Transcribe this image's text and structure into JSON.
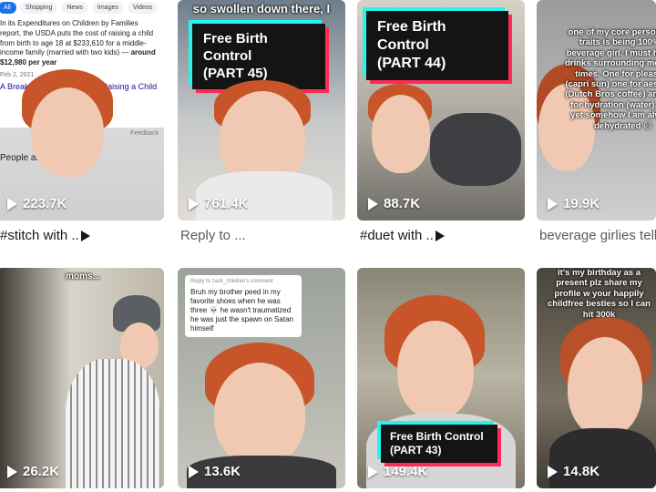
{
  "tiles": [
    {
      "views": "223.7K",
      "caption": "#stitch",
      "caption_rest": " with ..",
      "google": {
        "tabs": [
          "All",
          "Shopping",
          "News",
          "Images",
          "Videos"
        ],
        "snippet_pre": "In its Expenditures on Children by Families report, the USDA puts the cost of raising a child from birth to age 18 at $233,610 for a middle-income family (married with two kids) — ",
        "snippet_bold": "around $12,980 per year",
        "date": "Feb 2, 2021",
        "link": "A Breakdown of the Cost of Raising a Child",
        "feedback": "Feedback",
        "people": "People also ask"
      }
    },
    {
      "views": "761.4K",
      "caption": "Reply to ...",
      "top_text": "so swollen down there, I",
      "box_text": "Free Birth Control\n(PART 45)"
    },
    {
      "views": "88.7K",
      "caption": "#duet",
      "caption_rest": " with ..",
      "box_text": "Free Birth Control\n(PART 44)"
    },
    {
      "views": "19.9K",
      "caption": "beverage girlies tell",
      "overlay": "one of my core personality traits is being 100% a beverage girl. I must have 3 drinks surrounding me at all times. One for pleasure (capri sun) one for aesthetic (Dutch Bros coffee) and one for hydration (water). And yet somehow I am always dehydrated ☹"
    },
    {
      "views": "26.2K",
      "overlay": "moms..."
    },
    {
      "views": "13.6K",
      "reply_who": "Reply to zack_children's comment",
      "reply_text": "Bruh my brother peed in my favorite shoes when he was three 💀 he wasn't traumatized he was just the spawn on Satan himself"
    },
    {
      "views": "149.4K",
      "box_text": "Free Birth Control\n(PART 43)"
    },
    {
      "views": "14.8K",
      "overlay": "it's my birthday as a present plz share my profile w your happily childfree besties so I can hit 300k"
    }
  ],
  "colors": {
    "accent_cyan": "#25f4ee",
    "accent_pink": "#fe2c55",
    "hair": "#c8552a",
    "text": "#161823"
  },
  "icons": {
    "play": "play-icon"
  }
}
